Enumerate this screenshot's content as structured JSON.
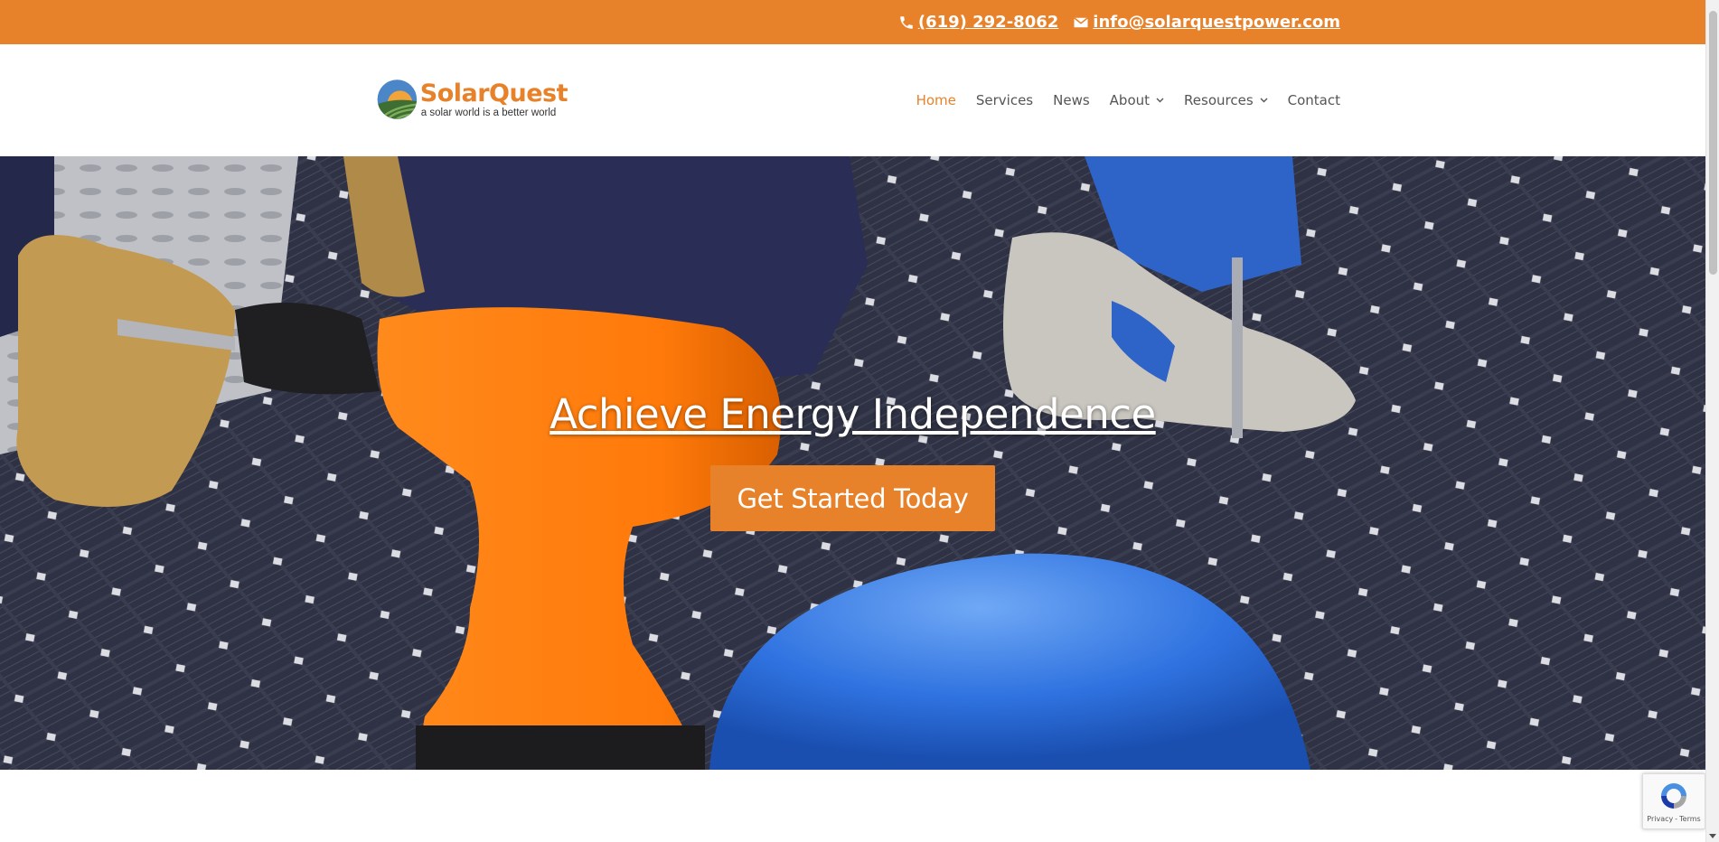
{
  "colors": {
    "brand_orange": "#e8822a",
    "nav_text": "#555555",
    "white": "#ffffff"
  },
  "topbar": {
    "phone": {
      "icon": "phone-icon",
      "text": "(619) 292-8062"
    },
    "email": {
      "icon": "envelope-icon",
      "text": "info@solarquestpower.com"
    }
  },
  "header": {
    "logo": {
      "icon": "solarquest-logo-mark",
      "brand": "SolarQuest",
      "tagline": "a solar world is a better world"
    },
    "nav": {
      "home": "Home",
      "services": "Services",
      "news": "News",
      "about": "About",
      "resources": "Resources",
      "contact": "Contact",
      "active": "Home"
    }
  },
  "hero": {
    "title": "Achieve Energy Independence",
    "cta": "Get Started Today"
  },
  "recaptcha": {
    "icon": "recaptcha-icon",
    "privacy": "Privacy",
    "separator": "-",
    "terms": "Terms"
  }
}
